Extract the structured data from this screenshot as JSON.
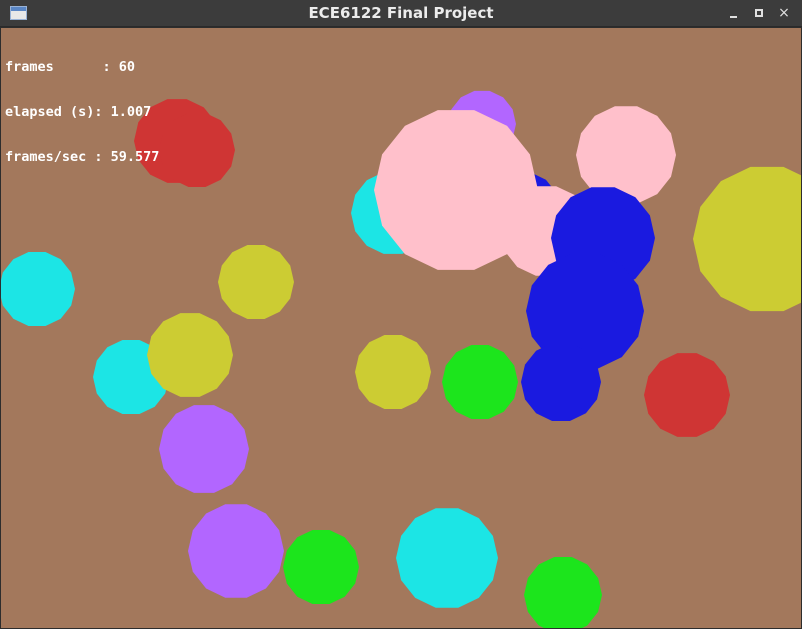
{
  "window": {
    "title": "ECE6122 Final Project",
    "minimize_glyph": "",
    "maximize_glyph": "",
    "close_glyph": "×"
  },
  "hud": {
    "frames": "frames      : 60",
    "elapsed": "elapsed (s): 1.007",
    "fps": "frames/sec : 59.577"
  },
  "colors": {
    "background": "#a3785c",
    "red": "#cf3534",
    "cyan": "#1ce5e5",
    "yellow": "#cccc33",
    "green": "#1ce51c",
    "purple": "#b266ff",
    "pink": "#ffc0cb",
    "blue": "#1a1ae0"
  },
  "scene": {
    "balls": [
      {
        "color": "red"
      },
      {
        "color": "red"
      },
      {
        "color": "purple"
      },
      {
        "color": "cyan"
      },
      {
        "color": "blue"
      },
      {
        "color": "pink"
      },
      {
        "color": "pink"
      },
      {
        "color": "pink"
      },
      {
        "color": "blue"
      },
      {
        "color": "blue"
      },
      {
        "color": "blue"
      },
      {
        "color": "yellow"
      },
      {
        "color": "cyan"
      },
      {
        "color": "yellow"
      },
      {
        "color": "cyan"
      },
      {
        "color": "yellow"
      },
      {
        "color": "yellow"
      },
      {
        "color": "green"
      },
      {
        "color": "red"
      },
      {
        "color": "purple"
      },
      {
        "color": "purple"
      },
      {
        "color": "green"
      },
      {
        "color": "cyan"
      },
      {
        "color": "green"
      }
    ]
  }
}
